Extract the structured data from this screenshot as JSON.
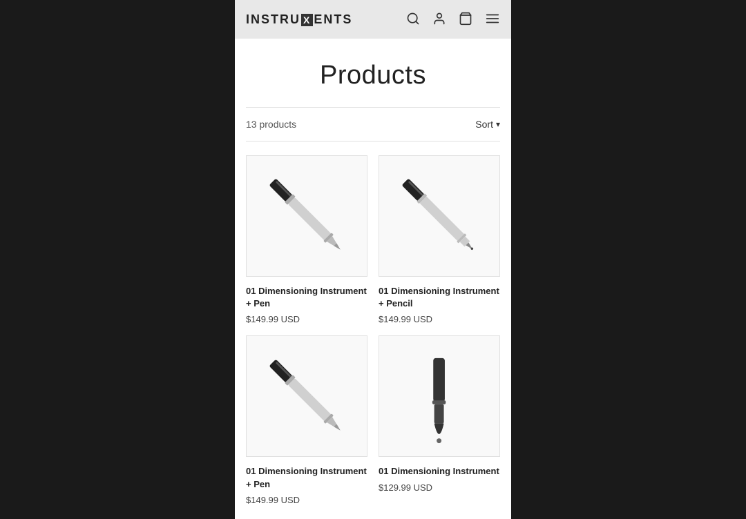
{
  "header": {
    "logo_text_before": "INSTRU",
    "logo_x": "X",
    "logo_text_after": "ENTS",
    "icons": {
      "search": "🔍",
      "user": "👤",
      "cart": "🛍",
      "menu": "☰"
    }
  },
  "page": {
    "title": "Products",
    "product_count_label": "13 products",
    "sort_label": "Sort"
  },
  "products": [
    {
      "id": 1,
      "name": "01 Dimensioning Instrument + Pen",
      "price": "$149.99 USD",
      "type": "pen"
    },
    {
      "id": 2,
      "name": "01 Dimensioning Instrument + Pencil",
      "price": "$149.99 USD",
      "type": "pencil"
    },
    {
      "id": 3,
      "name": "01 Dimensioning Instrument + Pen",
      "price": "$149.99 USD",
      "type": "pen"
    },
    {
      "id": 4,
      "name": "01 Dimensioning Instrument",
      "price": "$129.99 USD",
      "type": "stylus"
    }
  ]
}
